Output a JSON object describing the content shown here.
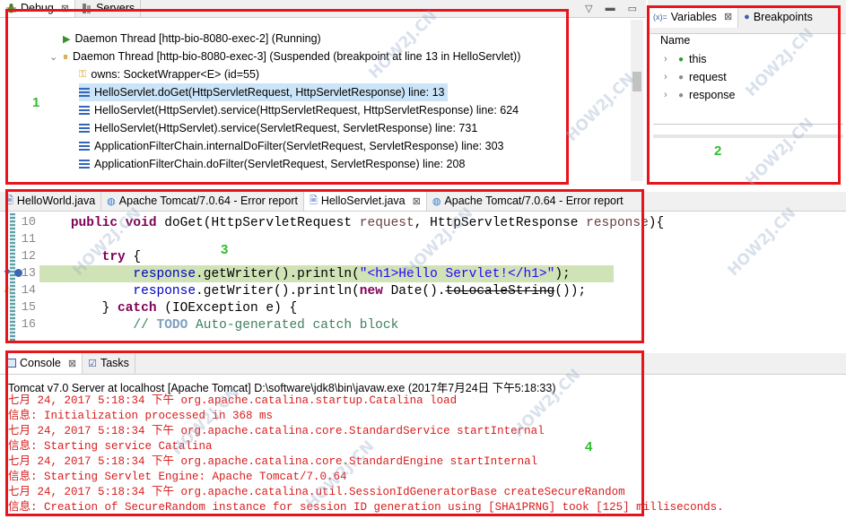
{
  "debug_view": {
    "tabs": [
      {
        "label": "Debug",
        "close": "⊠"
      },
      {
        "label": "Servers"
      }
    ],
    "threads": [
      {
        "label": "Daemon Thread [http-bio-8080-exec-2] (Running)"
      },
      {
        "label": "Daemon Thread [http-bio-8080-exec-3] (Suspended (breakpoint at line 13 in HelloServlet))"
      }
    ],
    "owns": "owns: SocketWrapper<E>  (id=55)",
    "frames": [
      "HelloServlet.doGet(HttpServletRequest, HttpServletResponse) line: 13",
      "HelloServlet(HttpServlet).service(HttpServletRequest, HttpServletResponse) line: 624",
      "HelloServlet(HttpServlet).service(ServletRequest, ServletResponse) line: 731",
      "ApplicationFilterChain.internalDoFilter(ServletRequest, ServletResponse) line: 303",
      "ApplicationFilterChain.doFilter(ServletRequest, ServletResponse) line: 208"
    ],
    "region_number": "1"
  },
  "variables_view": {
    "tabs": [
      {
        "label": "Variables",
        "prefix": "(x)="
      },
      {
        "label": "Breakpoints"
      }
    ],
    "column_header": "Name",
    "items": [
      "this",
      "request",
      "response"
    ],
    "region_number": "2"
  },
  "editor": {
    "tabs": [
      "HelloWorld.java",
      "Apache Tomcat/7.0.64 - Error report",
      "HelloServlet.java",
      "Apache Tomcat/7.0.64 - Error report"
    ],
    "line_numbers": [
      "10",
      "11",
      "12",
      "13",
      "14",
      "15",
      "16"
    ],
    "code": {
      "l10_kw1": "public",
      "l10_kw2": "void",
      "l10_rest": " doGet(HttpServletRequest ",
      "l10_p1": "request",
      "l10_mid": ", HttpServletResponse ",
      "l10_p2": "response",
      "l10_end": "){",
      "l12_kw": "try",
      "l12_end": " {",
      "l13_fld": "response",
      "l13_mid": ".getWriter().println(",
      "l13_str": "\"<h1>Hello Servlet!</h1>\"",
      "l13_end": ");",
      "l14_fld": "response",
      "l14_mid": ".getWriter().println(",
      "l14_kw": "new",
      "l14_date": " Date().",
      "l14_depr": "toLocaleString",
      "l14_end": "());",
      "l15_pre": "} ",
      "l15_kw": "catch",
      "l15_end": " (IOException e) {",
      "l16_cmt1": "// ",
      "l16_todo": "TODO",
      "l16_cmt2": " Auto-generated catch block"
    },
    "region_number": "3"
  },
  "console_view": {
    "tabs": [
      {
        "label": "Console"
      },
      {
        "label": "Tasks"
      }
    ],
    "header": "Tomcat v7.0 Server at localhost [Apache Tomcat] D:\\software\\jdk8\\bin\\javaw.exe (2017年7月24日 下午5:18:33)",
    "lines": [
      "七月 24, 2017 5:18:34 下午 org.apache.catalina.startup.Catalina load",
      "信息: Initialization processed in 368 ms",
      "七月 24, 2017 5:18:34 下午 org.apache.catalina.core.StandardService startInternal",
      "信息: Starting service Catalina",
      "七月 24, 2017 5:18:34 下午 org.apache.catalina.core.StandardEngine startInternal",
      "信息: Starting Servlet Engine: Apache Tomcat/7.0.64",
      "七月 24, 2017 5:18:34 下午 org.apache.catalina.util.SessionIdGeneratorBase createSecureRandom",
      "信息: Creation of SecureRandom instance for session ID generation using [SHA1PRNG] took [125] milliseconds."
    ],
    "region_number": "4"
  },
  "watermark_text": "HOW2J.CN",
  "colors": {
    "highlight_red": "#e8141b",
    "label_green": "#2fbf2a",
    "console_text": "#d81c1c",
    "keyword": "#7f0055",
    "string": "#2a00ff"
  }
}
